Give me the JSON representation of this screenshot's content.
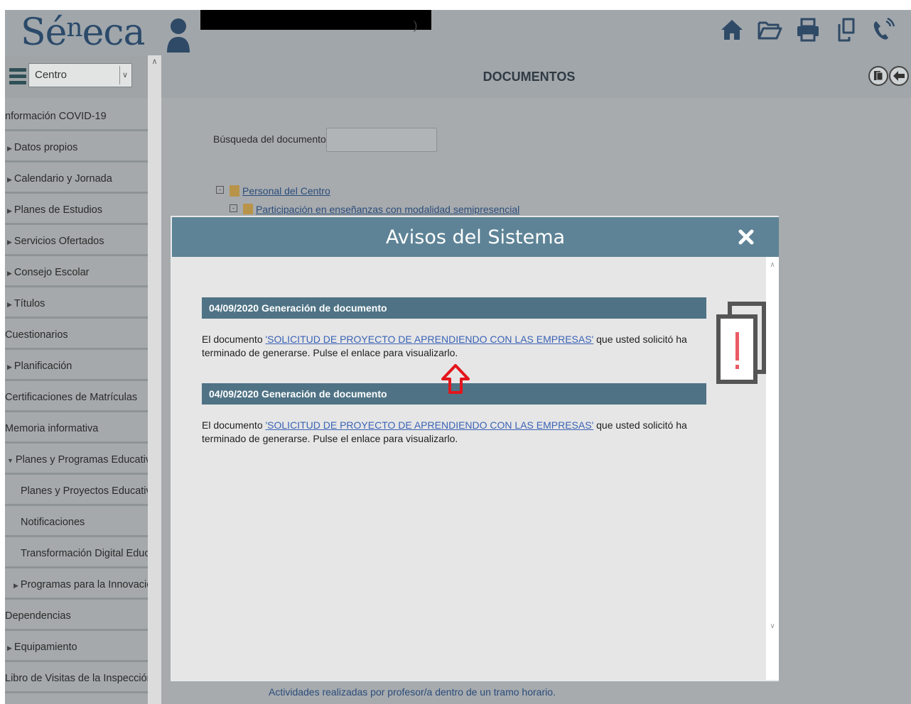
{
  "header": {
    "logo_main": "Sé",
    "logo_sup": "n",
    "logo_tail": "eca",
    "user_tail": ")",
    "icons": [
      "home-icon",
      "folder-open-icon",
      "print-icon",
      "copy-document-icon",
      "phone-icon"
    ]
  },
  "sidebar": {
    "select_value": "Centro",
    "items": [
      {
        "label": "nformación COVID-19",
        "arrow": false
      },
      {
        "label": "Datos propios",
        "arrow": true
      },
      {
        "label": "Calendario y Jornada",
        "arrow": true
      },
      {
        "label": "Planes de Estudios",
        "arrow": true
      },
      {
        "label": "Servicios Ofertados",
        "arrow": true
      },
      {
        "label": "Consejo Escolar",
        "arrow": true
      },
      {
        "label": "Títulos",
        "arrow": true
      },
      {
        "label": "Cuestionarios",
        "arrow": false
      },
      {
        "label": "Planificación",
        "arrow": true
      },
      {
        "label": "Certificaciones de Matrículas",
        "arrow": false
      },
      {
        "label": "Memoria informativa",
        "arrow": false
      },
      {
        "label": "Planes y Programas Educativos",
        "arrow": true,
        "expanded": true
      },
      {
        "label": "Planes y Proyectos Educativos",
        "arrow": false,
        "indent": true
      },
      {
        "label": "Notificaciones",
        "arrow": false,
        "indent": true
      },
      {
        "label": "Transformación Digital Educat",
        "arrow": false,
        "indent": true
      },
      {
        "label": "Programas para la Innovación",
        "arrow": true,
        "indent": true
      },
      {
        "label": "Dependencias",
        "arrow": false
      },
      {
        "label": "Equipamiento",
        "arrow": true
      },
      {
        "label": "Libro de Visitas de la Inspección",
        "arrow": false
      }
    ]
  },
  "main": {
    "title": "DOCUMENTOS",
    "search_label": "Búsqueda del documento:",
    "search_value": "",
    "tree": {
      "root": "Personal del Centro",
      "child": "Participación en enseñanzas con modalidad semipresencial",
      "bottom": "Actividades realizadas por profesor/a dentro de un tramo horario."
    }
  },
  "modal": {
    "title": "Avisos del Sistema",
    "notices": [
      {
        "heading": "04/09/2020 Generación de documento",
        "text_before": "El documento ",
        "link": "'SOLICITUD DE PROYECTO DE APRENDIENDO CON LAS EMPRESAS'",
        "text_after": " que usted solicitó ha terminado de generarse. Pulse el enlace para visualizarlo."
      },
      {
        "heading": "04/09/2020 Generación de documento",
        "text_before": "El documento ",
        "link": "'SOLICITUD DE PROYECTO DE APRENDIENDO CON LAS EMPRESAS'",
        "text_after": " que usted solicitó ha terminado de generarse. Pulse el enlace para visualizarlo."
      }
    ],
    "accent_color": "#5e8396",
    "arrow_color": "#e3151b"
  }
}
